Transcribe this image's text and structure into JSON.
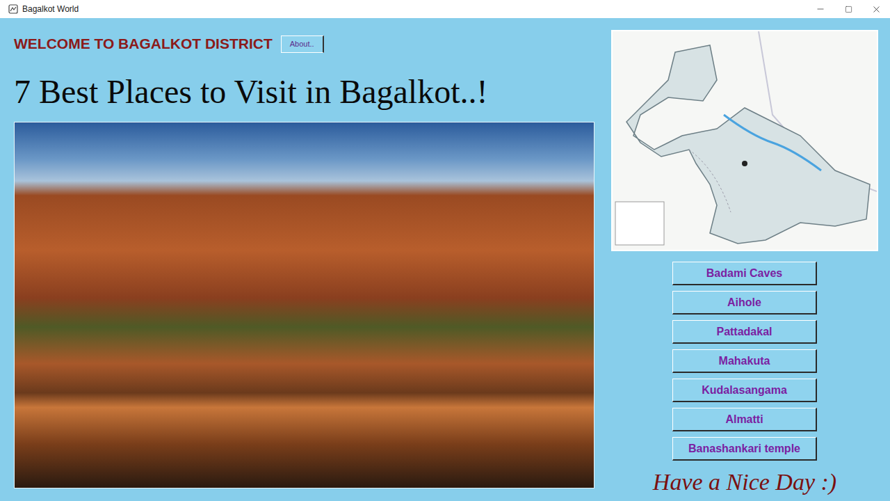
{
  "window": {
    "title": "Bagalkot World"
  },
  "header": {
    "welcome": "WELCOME TO BAGALKOT DISTRICT",
    "about_button": "About.."
  },
  "headline": "7 Best Places to Visit in Bagalkot..!",
  "places": [
    {
      "label": "Badami Caves"
    },
    {
      "label": "Aihole"
    },
    {
      "label": "Pattadakal"
    },
    {
      "label": "Mahakuta"
    },
    {
      "label": "Kudalasangama"
    },
    {
      "label": "Almatti"
    },
    {
      "label": "Banashankari temple"
    }
  ],
  "footer": "Have a Nice Day :)"
}
